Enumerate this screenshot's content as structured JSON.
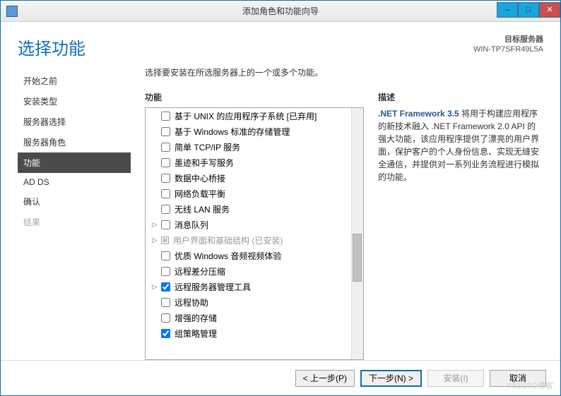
{
  "window": {
    "title": "添加角色和功能向导",
    "minimize": "–",
    "maximize": "□",
    "close": "✕"
  },
  "header": {
    "page_title": "选择功能",
    "target_label": "目标服务器",
    "server_name": "WIN-TP7SFR49L5A"
  },
  "sidebar": {
    "steps": [
      {
        "label": "开始之前",
        "state": "normal"
      },
      {
        "label": "安装类型",
        "state": "normal"
      },
      {
        "label": "服务器选择",
        "state": "normal"
      },
      {
        "label": "服务器角色",
        "state": "normal"
      },
      {
        "label": "功能",
        "state": "active"
      },
      {
        "label": "AD DS",
        "state": "normal"
      },
      {
        "label": "确认",
        "state": "normal"
      },
      {
        "label": "结果",
        "state": "disabled"
      }
    ]
  },
  "content": {
    "instruction": "选择要安装在所选服务器上的一个或多个功能。",
    "features_header": "功能",
    "desc_header": "描述",
    "features": [
      {
        "label": "基于 UNIX 的应用程序子系统 [已弃用]",
        "checked": false
      },
      {
        "label": "基于 Windows 标准的存储管理",
        "checked": false
      },
      {
        "label": "简单 TCP/IP 服务",
        "checked": false
      },
      {
        "label": "墨迹和手写服务",
        "checked": false
      },
      {
        "label": "数据中心桥接",
        "checked": false
      },
      {
        "label": "网络负载平衡",
        "checked": false
      },
      {
        "label": "无线 LAN 服务",
        "checked": false
      },
      {
        "label": "消息队列",
        "checked": false,
        "expandable": true
      },
      {
        "label": "用户界面和基础结构 (已安装)",
        "checked": true,
        "installed": true,
        "expandable": true
      },
      {
        "label": "优质 Windows 音频视频体验",
        "checked": false
      },
      {
        "label": "远程差分压缩",
        "checked": false
      },
      {
        "label": "远程服务器管理工具",
        "checked": true,
        "expandable": true
      },
      {
        "label": "远程协助",
        "checked": false
      },
      {
        "label": "增强的存储",
        "checked": false
      },
      {
        "label": "组策略管理",
        "checked": true
      }
    ],
    "description_bold": ".NET Framework 3.5",
    "description_rest": " 将用于构建应用程序的新技术融入 .NET Framework 2.0 API 的强大功能，该应用程序提供了漂亮的用户界面，保护客户的个人身份信息、实现无缝安全通信，并提供对一系列业务流程进行模拟的功能。"
  },
  "buttons": {
    "prev": "< 上一步(P)",
    "next": "下一步(N) >",
    "install": "安装(I)",
    "cancel": "取消"
  },
  "watermark": "©51CTO博客"
}
